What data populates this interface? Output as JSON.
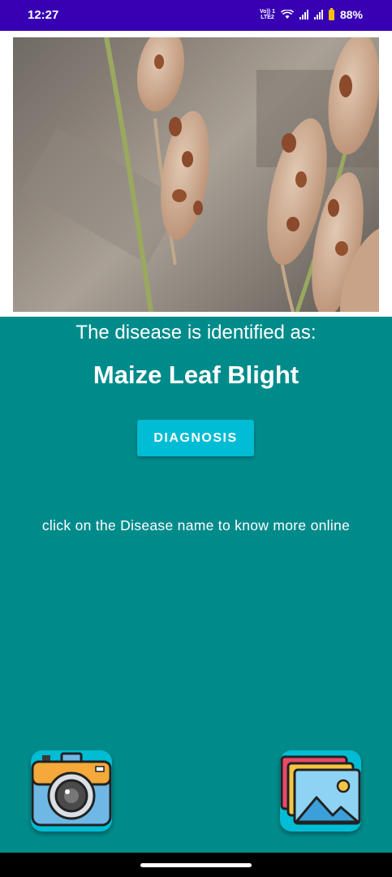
{
  "status_bar": {
    "time": "12:27",
    "volte_line1": "Vo)) 1",
    "volte_line2": "LTE2",
    "battery": "88%"
  },
  "main": {
    "identified_label": "The disease is identified as:",
    "disease_name": "Maize Leaf Blight",
    "diagnosis_button": "DIAGNOSIS",
    "hint": "click on the Disease name to know more online"
  },
  "icons": {
    "camera": "camera-icon",
    "gallery": "gallery-icon"
  },
  "colors": {
    "status_bar": "#3700b3",
    "background": "#008b8b",
    "accent": "#00bcd4"
  }
}
